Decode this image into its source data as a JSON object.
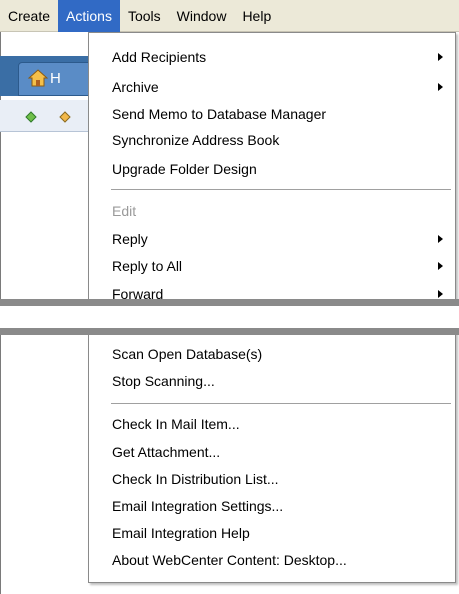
{
  "menubar": {
    "items": [
      {
        "label": "Create",
        "active": false
      },
      {
        "label": "Actions",
        "active": true
      },
      {
        "label": "Tools",
        "active": false
      },
      {
        "label": "Window",
        "active": false
      },
      {
        "label": "Help",
        "active": false
      }
    ]
  },
  "background": {
    "tab_text": "H"
  },
  "menu": {
    "group1": [
      "Add Recipients",
      "Archive",
      "Send Memo to Database Manager",
      "Synchronize Address Book",
      "Upgrade Folder Design"
    ],
    "group2": [
      "Edit",
      "Reply",
      "Reply to All",
      "Forward"
    ],
    "group3": [
      "Scan Open Database(s)",
      "Stop Scanning..."
    ],
    "group4": [
      "Check In Mail Item...",
      "Get Attachment...",
      "Check In Distribution List...",
      "Email Integration Settings...",
      "Email Integration Help",
      "About WebCenter Content: Desktop..."
    ]
  },
  "colors": {
    "menu_highlight": "#316ac5",
    "disabled_text": "#9a9a9a"
  }
}
